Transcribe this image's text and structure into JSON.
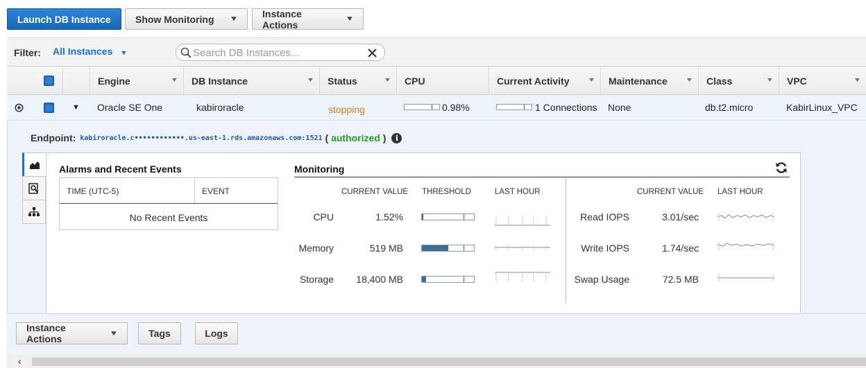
{
  "toolbar": {
    "launch_label": "Launch DB Instance",
    "monitoring_label": "Show Monitoring",
    "actions_label": "Instance Actions"
  },
  "filter": {
    "label": "Filter:",
    "selected": "All Instances",
    "search_placeholder": "Search DB Instances..."
  },
  "columns": [
    "Engine",
    "DB Instance",
    "Status",
    "CPU",
    "Current Activity",
    "Maintenance",
    "Class",
    "VPC"
  ],
  "row": {
    "engine": "Oracle SE One",
    "db_instance": "kabiroracle",
    "status": "stopping",
    "cpu": "0.98%",
    "cpu_fraction": 0.0098,
    "activity": "1 Connections",
    "maintenance": "None",
    "class": "db.t2.micro",
    "vpc": "KabirLinux_VPC"
  },
  "detail": {
    "endpoint_label": "Endpoint:",
    "endpoint_value": "kabiroracle.c••••••••••••.us-east-1.rds.amazonaws.com:1521",
    "auth_open": "(",
    "auth_status": "authorized",
    "auth_close": ")",
    "tab_icons": [
      "area-chart-icon",
      "magnifier-doc-icon",
      "hierarchy-icon"
    ],
    "alarms": {
      "title": "Alarms and Recent Events",
      "col_time": "TIME (UTC-5)",
      "col_event": "EVENT",
      "empty": "No Recent Events"
    },
    "monitoring": {
      "title": "Monitoring",
      "left_headers": [
        "CURRENT VALUE",
        "THRESHOLD",
        "LAST HOUR"
      ],
      "right_headers": [
        "CURRENT VALUE",
        "LAST HOUR"
      ],
      "left_metrics": [
        {
          "label": "CPU",
          "value": "1.52%",
          "fill": 0.02
        },
        {
          "label": "Memory",
          "value": "519 MB",
          "fill": 0.5
        },
        {
          "label": "Storage",
          "value": "18,400 MB",
          "fill": 0.08
        }
      ],
      "right_metrics": [
        {
          "label": "Read IOPS",
          "value": "3.01/sec"
        },
        {
          "label": "Write IOPS",
          "value": "1.74/sec"
        },
        {
          "label": "Swap Usage",
          "value": "72.5 MB"
        }
      ]
    }
  },
  "bottom": {
    "actions_label": "Instance Actions",
    "tags_label": "Tags",
    "logs_label": "Logs"
  },
  "colors": {
    "primary": "#1f6dc6",
    "status_stopping": "#e07b1f",
    "authorized": "#2a9a2a",
    "fill": "#3f6b94"
  }
}
